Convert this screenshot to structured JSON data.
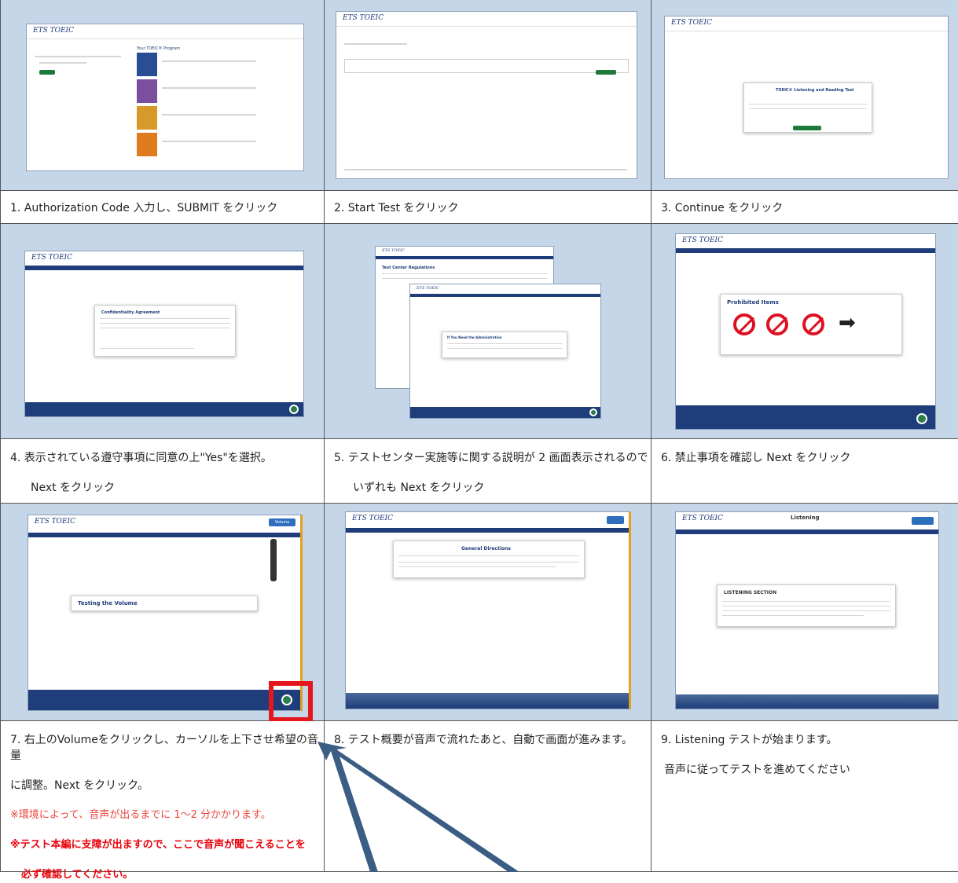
{
  "steps": [
    {
      "lines": [
        {
          "text": "1. Authorization Code 入力し、SUBMIT をクリック",
          "style": ""
        }
      ]
    },
    {
      "lines": [
        {
          "text": "2. Start Test をクリック",
          "style": ""
        }
      ]
    },
    {
      "lines": [
        {
          "text": "3. Continue をクリック",
          "style": ""
        }
      ]
    },
    {
      "lines": [
        {
          "text": "4. 表示されている遵守事項に同意の上\"Yes\"を選択。",
          "style": ""
        },
        {
          "text": "Next をクリック",
          "style": "indent"
        }
      ]
    },
    {
      "lines": [
        {
          "text": "5. テストセンター実施等に関する説明が 2 画面表示されるので",
          "style": ""
        },
        {
          "text": "いずれも Next をクリック",
          "style": "indent"
        }
      ]
    },
    {
      "lines": [
        {
          "text": "6. 禁止事項を確認し Next をクリック",
          "style": ""
        }
      ]
    },
    {
      "lines": [
        {
          "text": "7. 右上のVolumeをクリックし、カーソルを上下させ希望の音量",
          "style": ""
        },
        {
          "text": "に調整。Next をクリック。",
          "style": ""
        },
        {
          "text": "※環境によって、音声が出るまでに 1～2 分かかります。",
          "style": "red"
        },
        {
          "text": "※テスト本編に支障が出ますので、ここで音声が聞こえることを",
          "style": "redb"
        },
        {
          "text": "必ず確認してください。",
          "style": "redb indent"
        }
      ]
    },
    {
      "lines": [
        {
          "text": "8. テスト概要が音声で流れたあと、自動で画面が進みます。",
          "style": ""
        }
      ]
    },
    {
      "lines": [
        {
          "text": "9. Listening テストが始まります。",
          "style": ""
        },
        {
          "text": "音声に従ってテストを進めてください",
          "style": "indent"
        }
      ]
    }
  ],
  "screens": {
    "logo": "ETS TOEIC",
    "confidentiality": "Confidentiality Agreement",
    "need_admin": "If You Need the Administration",
    "test_center": "Test Center Regulations",
    "prohibited": "Prohibited Items",
    "testing_volume": "Testing the Volume",
    "general_directions": "General Directions",
    "listening": "Listening",
    "listening_section": "LISTENING SECTION",
    "volume": "Volume",
    "continue": "Continue",
    "submit": "Submit",
    "start_test": "Start Test",
    "next": "Next",
    "your_toeic_program": "Your TOEIC® Program",
    "listening_reading_test": "TOEIC® Listening and Reading Test"
  }
}
